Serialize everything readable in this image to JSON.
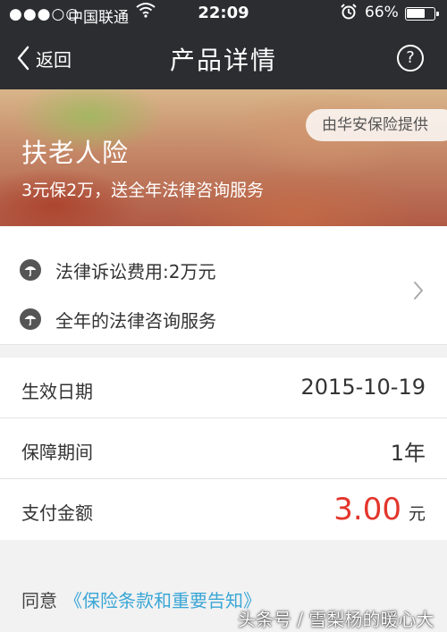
{
  "status_bar": {
    "signal": "●●●○○",
    "carrier": "中国联通",
    "time": "22:09",
    "battery_percent": "66%",
    "battery_level": 0.66
  },
  "nav": {
    "back_label": "返回",
    "title": "产品详情",
    "help_glyph": "?"
  },
  "banner": {
    "provider_badge": "由华安保险提供",
    "product_name": "扶老人险",
    "product_subtitle": "3元保2万，送全年法律咨询服务"
  },
  "coverage": {
    "items": [
      {
        "label": "法律诉讼费用:2万元",
        "icon": "umbrella-icon"
      },
      {
        "label": "全年的法律咨询服务",
        "icon": "umbrella-icon"
      }
    ]
  },
  "details": {
    "effective_date_label": "生效日期",
    "effective_date_value": "2015-10-19",
    "period_label": "保障期间",
    "period_value": "1年",
    "payment_label": "支付金额",
    "payment_amount": "3.00",
    "payment_unit": "元"
  },
  "agreement": {
    "prefix": "同意",
    "link_text": "《保险条款和重要告知》"
  },
  "watermark": "头条号 / 雪梨杨的暖心大白",
  "colors": {
    "header_bg": "#2b2d30",
    "amount_red": "#e3352b",
    "link_blue": "#3aa6d6"
  }
}
